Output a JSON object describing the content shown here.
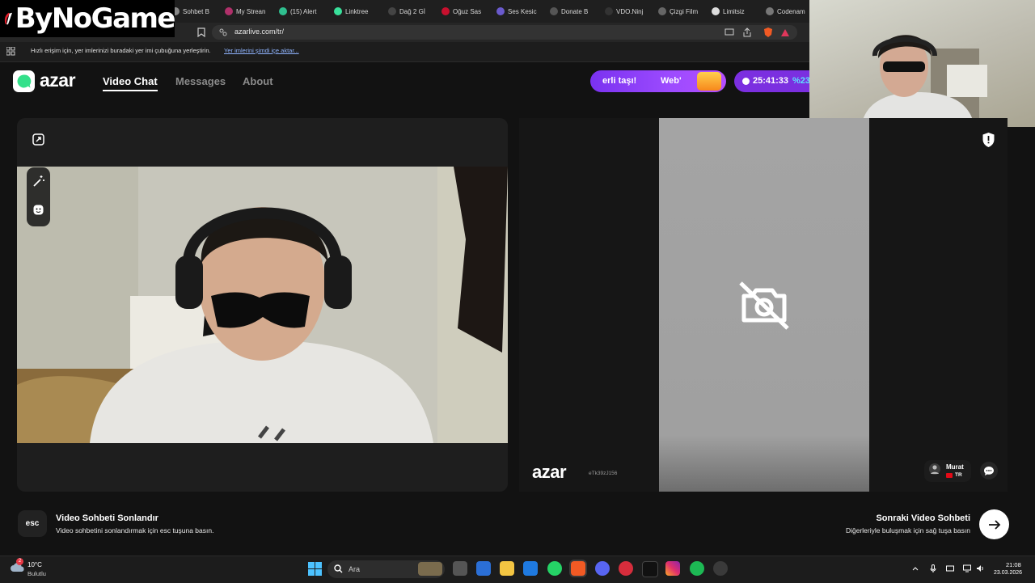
{
  "browser": {
    "tabs": [
      {
        "label": "Sohbet B",
        "color": "#888888"
      },
      {
        "label": "My Strean",
        "color": "#b0306a"
      },
      {
        "label": "(15) Alert",
        "color": "#2fbf8f"
      },
      {
        "label": "Linktree",
        "color": "#39e09b"
      },
      {
        "label": "Dağ 2 Gİ",
        "color": "#444444"
      },
      {
        "label": "Oğuz Sas",
        "color": "#c8102e"
      },
      {
        "label": "Ses Kesic",
        "color": "#6a5acd"
      },
      {
        "label": "Donate B",
        "color": "#555555"
      },
      {
        "label": "VDO.Ninj",
        "color": "#333333"
      },
      {
        "label": "Çizgi Film",
        "color": "#666666"
      },
      {
        "label": "Limitsiz",
        "color": "#dddddd"
      },
      {
        "label": "Codenam",
        "color": "#777777"
      }
    ],
    "url": "azarlive.com/tr/",
    "bookmark_hint": "Hızlı erişim için, yer imlerinizi buradaki yer imi çubuğuna yerleştirin.",
    "bookmark_link": "Yer imlerini şimdi içe aktar..."
  },
  "overlay_logo": {
    "text": "ByNoGame"
  },
  "azar": {
    "logo_text": "azar",
    "nav": {
      "video_chat": "Video Chat",
      "messages": "Messages",
      "about": "About"
    },
    "promo1": {
      "text_left": "erli taşı!",
      "text_right": "Web'"
    },
    "promo2": {
      "time": "25:41:33",
      "percent": "%23"
    },
    "accent": "#8a3cf5"
  },
  "chat": {
    "watermark": "azar",
    "peer_id": "eTk39zJ156",
    "peer_name": "Murat",
    "peer_country": "TR",
    "end": {
      "key": "esc",
      "title": "Video Sohbeti Sonlandır",
      "desc": "Video sohbetini sonlandırmak için esc tuşuna basın."
    },
    "next": {
      "title": "Sonraki Video Sohbeti",
      "desc": "Diğerleriyle buluşmak için sağ tuşa basın"
    }
  },
  "taskbar": {
    "weather_temp": "10°C",
    "weather_desc": "Bulutlu",
    "weather_badge": "2",
    "search_placeholder": "Ara",
    "time": "21:08",
    "date": "23.03.2026"
  }
}
